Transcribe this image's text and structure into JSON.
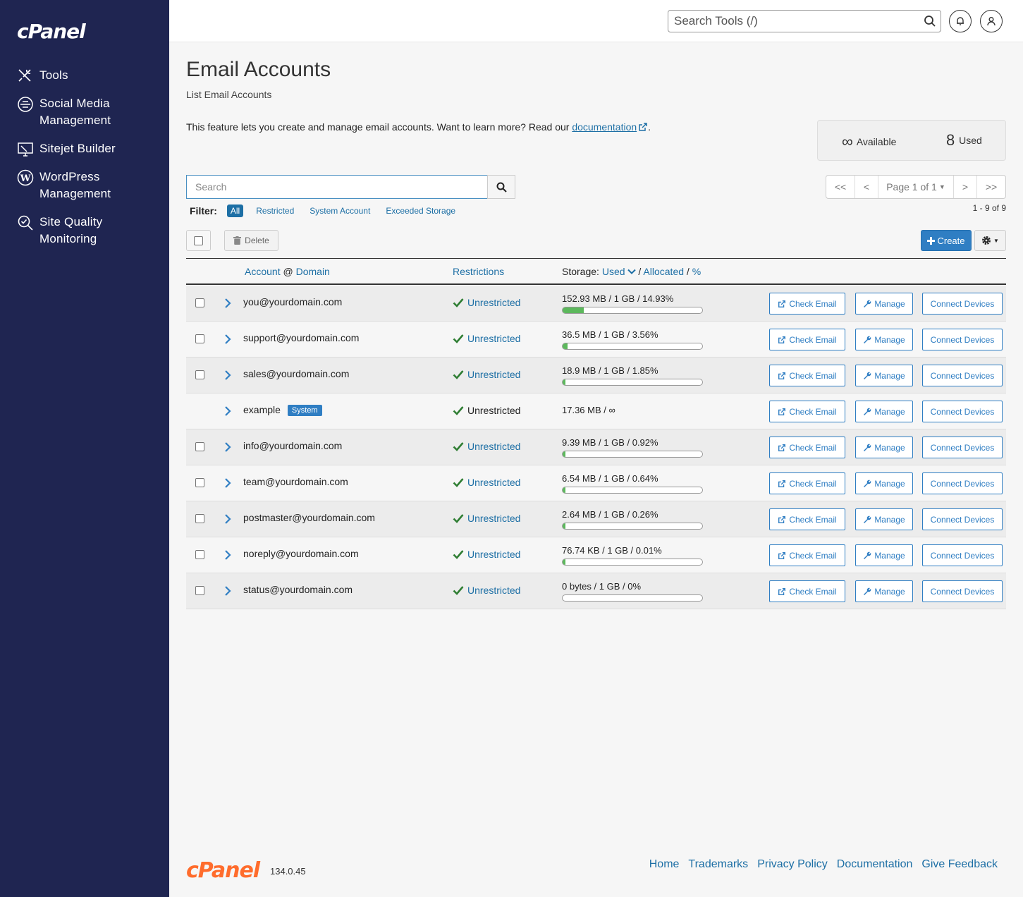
{
  "sidebar": {
    "logo": "cPanel",
    "items": [
      {
        "label": "Tools",
        "icon": "tools-icon"
      },
      {
        "label": "Social Media Management",
        "icon": "social-media-icon"
      },
      {
        "label": "Sitejet Builder",
        "icon": "sitejet-icon"
      },
      {
        "label": "WordPress Management",
        "icon": "wordpress-icon"
      },
      {
        "label": "Site Quality Monitoring",
        "icon": "site-quality-icon"
      }
    ]
  },
  "topbar": {
    "search_placeholder": "Search Tools (/)"
  },
  "page": {
    "title": "Email Accounts",
    "subtitle": "List Email Accounts",
    "intro_text": "This feature lets you create and manage email accounts. Want to learn more? Read our",
    "intro_link": "documentation",
    "intro_end": "."
  },
  "quota": {
    "available_symbol": "∞",
    "available_label": "Available",
    "used_count": "8",
    "used_label": "Used"
  },
  "list": {
    "search_placeholder": "Search",
    "filter_label": "Filter:",
    "filters": [
      "All",
      "Restricted",
      "System Account",
      "Exceeded Storage"
    ],
    "active_filter": "All",
    "delete_label": "Delete",
    "create_label": "Create",
    "pager": {
      "first": "<<",
      "prev": "<",
      "page": "Page 1 of 1",
      "next": ">",
      "last": ">>"
    },
    "range": "1 - 9 of 9"
  },
  "table": {
    "headers": {
      "account": "Account",
      "at": "@",
      "domain": "Domain",
      "restrictions": "Restrictions",
      "storage": "Storage:",
      "used": "Used",
      "sep1": "/",
      "allocated": "Allocated",
      "sep2": "/",
      "percent": "%"
    },
    "buttons": {
      "check": "Check Email",
      "manage": "Manage",
      "connect": "Connect Devices"
    },
    "rows": [
      {
        "account": "you@yourdomain.com",
        "restriction": "Unrestricted",
        "storage": "152.93 MB / 1 GB / 14.93%",
        "pct": 14.93,
        "checkbox": true
      },
      {
        "account": "support@yourdomain.com",
        "restriction": "Unrestricted",
        "storage": "36.5 MB / 1 GB / 3.56%",
        "pct": 3.56,
        "checkbox": true
      },
      {
        "account": "sales@yourdomain.com",
        "restriction": "Unrestricted",
        "storage": "18.9 MB / 1 GB / 1.85%",
        "pct": 1.85,
        "checkbox": true
      },
      {
        "account": "example",
        "badge": "System",
        "restriction": "Unrestricted",
        "storage": "17.36 MB / ∞",
        "pct": null,
        "checkbox": false
      },
      {
        "account": "info@yourdomain.com",
        "restriction": "Unrestricted",
        "storage": "9.39 MB / 1 GB / 0.92%",
        "pct": 0.92,
        "checkbox": true
      },
      {
        "account": "team@yourdomain.com",
        "restriction": "Unrestricted",
        "storage": "6.54 MB / 1 GB / 0.64%",
        "pct": 0.64,
        "checkbox": true
      },
      {
        "account": "postmaster@yourdomain.com",
        "restriction": "Unrestricted",
        "storage": "2.64 MB / 1 GB / 0.26%",
        "pct": 0.26,
        "checkbox": true
      },
      {
        "account": "noreply@yourdomain.com",
        "restriction": "Unrestricted",
        "storage": "76.74 KB / 1 GB / 0.01%",
        "pct": 0.01,
        "checkbox": true
      },
      {
        "account": "status@yourdomain.com",
        "restriction": "Unrestricted",
        "storage": "0 bytes / 1 GB / 0%",
        "pct": 0,
        "checkbox": true
      }
    ]
  },
  "footer": {
    "logo": "cPanel",
    "version": "134.0.45",
    "links": [
      "Home",
      "Trademarks",
      "Privacy Policy",
      "Documentation",
      "Give Feedback"
    ]
  },
  "colors": {
    "sidebar_bg": "#1f2551",
    "accent": "#2f7ec3",
    "link": "#1d6fa5",
    "footer_logo": "#ff6c2c",
    "bar_fill": "#5cb85c"
  }
}
